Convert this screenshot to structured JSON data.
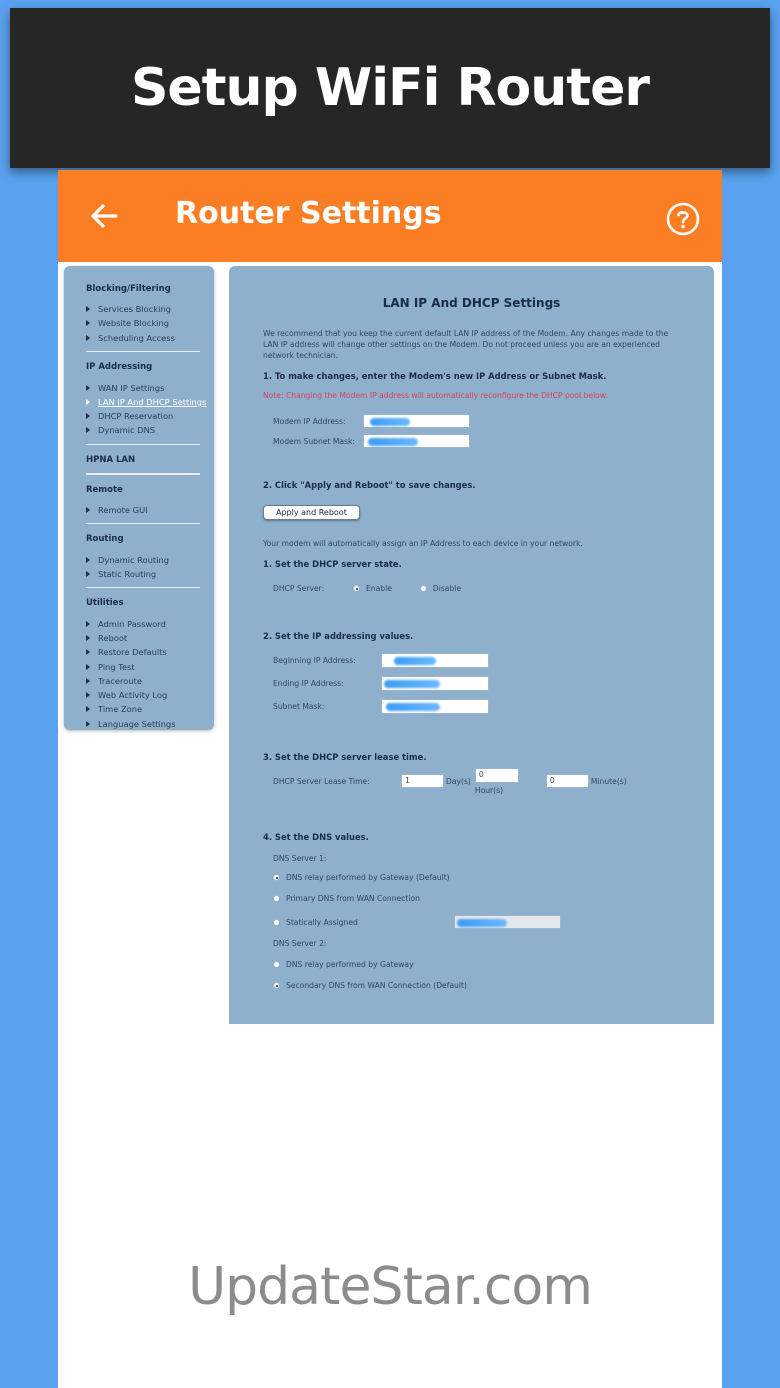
{
  "banner": {
    "title": "Setup WiFi Router"
  },
  "appbar": {
    "title": "Router Settings",
    "back_icon": "arrow-left-icon",
    "help_icon": "help-circle-icon"
  },
  "colors": {
    "background": "#5aa2f0",
    "appbar": "#fb7d24",
    "panel": "#8fb0cc",
    "note": "#d8425e"
  },
  "sidebar": {
    "sections": [
      {
        "heading": "Blocking/Filtering",
        "items": [
          "Services Blocking",
          "Website Blocking",
          "Scheduling Access"
        ]
      },
      {
        "heading": "IP Addressing",
        "items": [
          "WAN IP Settings",
          "LAN IP And DHCP Settings",
          "DHCP Reservation",
          "Dynamic DNS"
        ]
      },
      {
        "heading": "HPNA LAN",
        "items": []
      },
      {
        "heading": "Remote",
        "items": [
          "Remote GUI"
        ]
      },
      {
        "heading": "Routing",
        "items": [
          "Dynamic Routing",
          "Static Routing"
        ]
      },
      {
        "heading": "Utilities",
        "items": [
          "Admin Password",
          "Reboot",
          "Restore Defaults",
          "Ping Test",
          "Traceroute",
          "Web Activity Log",
          "Time Zone",
          "Language Settings"
        ]
      }
    ],
    "active_item": "LAN IP And DHCP Settings"
  },
  "panel": {
    "title": "LAN IP And DHCP Settings",
    "intro": "We recommend that you keep the current default LAN IP address of the Modem. Any changes made to the LAN IP address will change other settings on the Modem. Do not proceed unless you are an experienced network technician.",
    "step1": "1. To make changes, enter the Modem's new IP Address or Subnet Mask.",
    "note": "Note: Changing the Modem IP address will automatically reconfigure the DHCP pool below.",
    "modem_ip_label": "Modem IP Address:",
    "modem_mask_label": "Modem Subnet Mask:",
    "step2": "2. Click \"Apply and Reboot\" to save changes.",
    "apply_button": "Apply and Reboot",
    "auto_assign": "Your modem will automatically assign an IP Address to each device in your network.",
    "dhcp_state_step": "1. Set the DHCP server state.",
    "dhcp_server_label": "DHCP Server:",
    "enable_label": "Enable",
    "disable_label": "Disable",
    "addressing_step": "2. Set the IP addressing values.",
    "begin_ip_label": "Beginning IP Address:",
    "end_ip_label": "Ending IP Address:",
    "subnet_label": "Subnet Mask:",
    "lease_step": "3. Set the DHCP server lease time.",
    "lease_label": "DHCP Server Lease Time:",
    "lease_days": "1",
    "days_unit": "Day(s)",
    "lease_hours": "0",
    "hours_unit": "Hour(s)",
    "lease_minutes": "0",
    "minutes_unit": "Minute(s)",
    "dns_step": "4. Set the DNS values.",
    "dns1_label": "DNS Server 1:",
    "dns1_opt1": "DNS relay performed by Gateway (Default)",
    "dns1_opt2": "Primary DNS from WAN Connection",
    "dns1_opt3": "Statically Assigned",
    "dns2_label": "DNS Server 2:",
    "dns2_opt1": "DNS relay performed by Gateway",
    "dns2_opt2": "Secondary DNS from WAN Connection (Default)"
  },
  "watermark": "UpdateStar.com"
}
